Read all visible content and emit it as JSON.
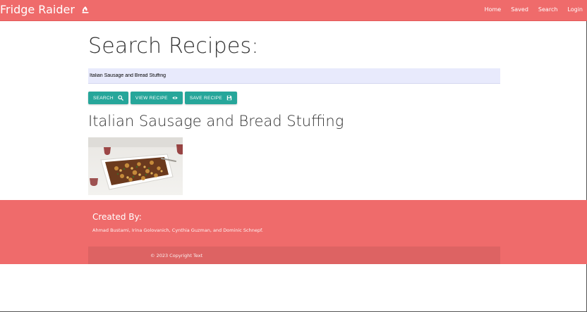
{
  "navbar": {
    "brand": "Fridge Raider",
    "brand_icon": "fire-icon",
    "links": [
      "Home",
      "Saved",
      "Search",
      "Login"
    ]
  },
  "main": {
    "title": "Search Recipes:",
    "search_value": "Italian Sausage and Bread Stuffing",
    "buttons": {
      "search": "SEARCH",
      "view": "VIEW RECIPE",
      "save": "SAVE RECIPE"
    },
    "recipe_title": "Italian Sausage and Bread Stuffing"
  },
  "footer": {
    "heading": "Created By:",
    "authors": "Ahmad Bustami, Irina Golovanich, Cynthia Guzman, and Dominic Schnepf.",
    "copyright": "© 2023 Copyright Text"
  },
  "colors": {
    "navbar": "#ef6b6b",
    "button": "#26a69a",
    "search_field": "#e8eafc",
    "footer": "#ef6b6b",
    "copyright_bar": "#dd6363"
  }
}
